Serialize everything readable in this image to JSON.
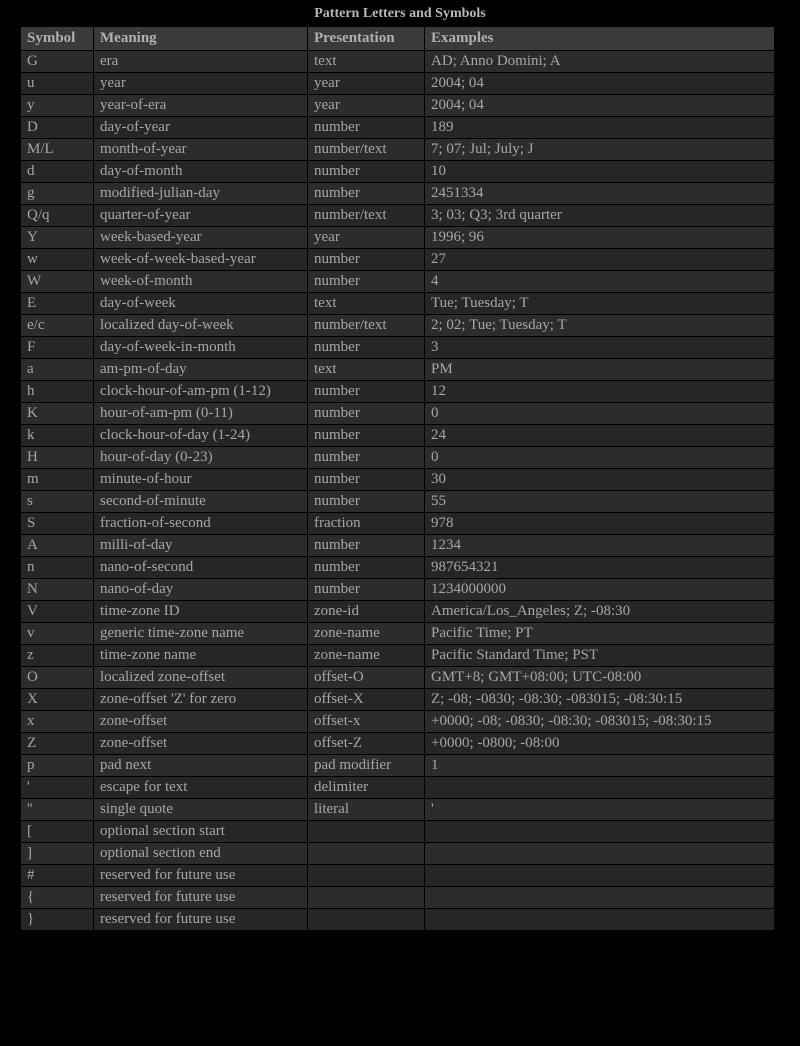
{
  "caption": "Pattern Letters and Symbols",
  "headers": [
    "Symbol",
    "Meaning",
    "Presentation",
    "Examples"
  ],
  "rows": [
    [
      "G",
      "era",
      "text",
      "AD; Anno Domini; A"
    ],
    [
      "u",
      "year",
      "year",
      "2004; 04"
    ],
    [
      "y",
      "year-of-era",
      "year",
      "2004; 04"
    ],
    [
      "D",
      "day-of-year",
      "number",
      "189"
    ],
    [
      "M/L",
      "month-of-year",
      "number/text",
      "7; 07; Jul; July; J"
    ],
    [
      "d",
      "day-of-month",
      "number",
      "10"
    ],
    [
      "g",
      "modified-julian-day",
      "number",
      "2451334"
    ],
    [
      "Q/q",
      "quarter-of-year",
      "number/text",
      "3; 03; Q3; 3rd quarter"
    ],
    [
      "Y",
      "week-based-year",
      "year",
      "1996; 96"
    ],
    [
      "w",
      "week-of-week-based-year",
      "number",
      "27"
    ],
    [
      "W",
      "week-of-month",
      "number",
      "4"
    ],
    [
      "E",
      "day-of-week",
      "text",
      "Tue; Tuesday; T"
    ],
    [
      "e/c",
      "localized day-of-week",
      "number/text",
      "2; 02; Tue; Tuesday; T"
    ],
    [
      "F",
      "day-of-week-in-month",
      "number",
      "3"
    ],
    [
      "a",
      "am-pm-of-day",
      "text",
      "PM"
    ],
    [
      "h",
      "clock-hour-of-am-pm (1-12)",
      "number",
      "12"
    ],
    [
      "K",
      "hour-of-am-pm (0-11)",
      "number",
      "0"
    ],
    [
      "k",
      "clock-hour-of-day (1-24)",
      "number",
      "24"
    ],
    [
      "H",
      "hour-of-day (0-23)",
      "number",
      "0"
    ],
    [
      "m",
      "minute-of-hour",
      "number",
      "30"
    ],
    [
      "s",
      "second-of-minute",
      "number",
      "55"
    ],
    [
      "S",
      "fraction-of-second",
      "fraction",
      "978"
    ],
    [
      "A",
      "milli-of-day",
      "number",
      "1234"
    ],
    [
      "n",
      "nano-of-second",
      "number",
      "987654321"
    ],
    [
      "N",
      "nano-of-day",
      "number",
      "1234000000"
    ],
    [
      "V",
      "time-zone ID",
      "zone-id",
      "America/Los_Angeles; Z; -08:30"
    ],
    [
      "v",
      "generic time-zone name",
      "zone-name",
      "Pacific Time; PT"
    ],
    [
      "z",
      "time-zone name",
      "zone-name",
      "Pacific Standard Time; PST"
    ],
    [
      "O",
      "localized zone-offset",
      "offset-O",
      "GMT+8; GMT+08:00; UTC-08:00"
    ],
    [
      "X",
      "zone-offset 'Z' for zero",
      "offset-X",
      "Z; -08; -0830; -08:30; -083015; -08:30:15"
    ],
    [
      "x",
      "zone-offset",
      "offset-x",
      "+0000; -08; -0830; -08:30; -083015; -08:30:15"
    ],
    [
      "Z",
      "zone-offset",
      "offset-Z",
      "+0000; -0800; -08:00"
    ],
    [
      "p",
      "pad next",
      "pad modifier",
      "1"
    ],
    [
      "'",
      "escape for text",
      "delimiter",
      ""
    ],
    [
      "''",
      "single quote",
      "literal",
      "'"
    ],
    [
      "[",
      "optional section start",
      "",
      ""
    ],
    [
      "]",
      "optional section end",
      "",
      ""
    ],
    [
      "#",
      "reserved for future use",
      "",
      ""
    ],
    [
      "{",
      "reserved for future use",
      "",
      ""
    ],
    [
      "}",
      "reserved for future use",
      "",
      ""
    ]
  ]
}
